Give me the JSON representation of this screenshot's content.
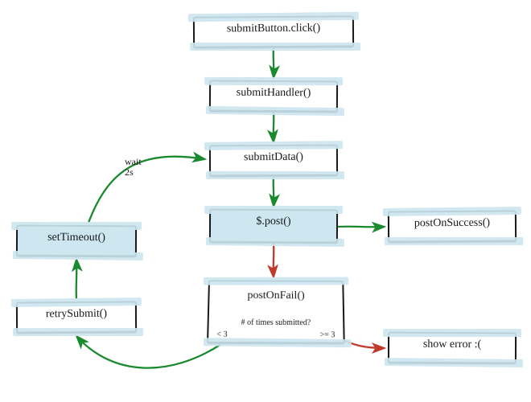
{
  "nodes": {
    "click": {
      "label": "submitButton.click()"
    },
    "handler": {
      "label": "submitHandler()"
    },
    "data": {
      "label": "submitData()"
    },
    "post": {
      "label": "$.post()"
    },
    "success": {
      "label": "postOnSuccess()"
    },
    "fail": {
      "label": "postOnFail()",
      "subtitle": "# of times submitted?",
      "branch_lt": "< 3",
      "branch_gte": ">= 3"
    },
    "error": {
      "label": "show error :("
    },
    "retry": {
      "label": "retrySubmit()"
    },
    "timeout": {
      "label": "setTimeout()"
    }
  },
  "edges": {
    "wait": {
      "label": "wait\n2s"
    }
  },
  "chart_data": {
    "type": "flowchart",
    "nodes": [
      {
        "id": "click",
        "label": "submitButton.click()",
        "highlight": false
      },
      {
        "id": "handler",
        "label": "submitHandler()",
        "highlight": false
      },
      {
        "id": "data",
        "label": "submitData()",
        "highlight": false
      },
      {
        "id": "post",
        "label": "$.post()",
        "highlight": true
      },
      {
        "id": "success",
        "label": "postOnSuccess()",
        "highlight": false
      },
      {
        "id": "fail",
        "label": "postOnFail()",
        "highlight": false,
        "internal_text": "# of times submitted?",
        "branches": {
          "< 3": "retry",
          ">= 3": "error"
        }
      },
      {
        "id": "error",
        "label": "show error :(",
        "highlight": false
      },
      {
        "id": "retry",
        "label": "retrySubmit()",
        "highlight": false
      },
      {
        "id": "timeout",
        "label": "setTimeout()",
        "highlight": true
      }
    ],
    "edges": [
      {
        "from": "click",
        "to": "handler",
        "color": "green"
      },
      {
        "from": "handler",
        "to": "data",
        "color": "green"
      },
      {
        "from": "data",
        "to": "post",
        "color": "green"
      },
      {
        "from": "post",
        "to": "success",
        "color": "green"
      },
      {
        "from": "post",
        "to": "fail",
        "color": "red"
      },
      {
        "from": "fail",
        "to": "error",
        "color": "red",
        "condition": ">= 3"
      },
      {
        "from": "fail",
        "to": "retry",
        "color": "green",
        "condition": "< 3"
      },
      {
        "from": "retry",
        "to": "timeout",
        "color": "green"
      },
      {
        "from": "timeout",
        "to": "data",
        "color": "green",
        "label": "wait 2s"
      }
    ]
  }
}
